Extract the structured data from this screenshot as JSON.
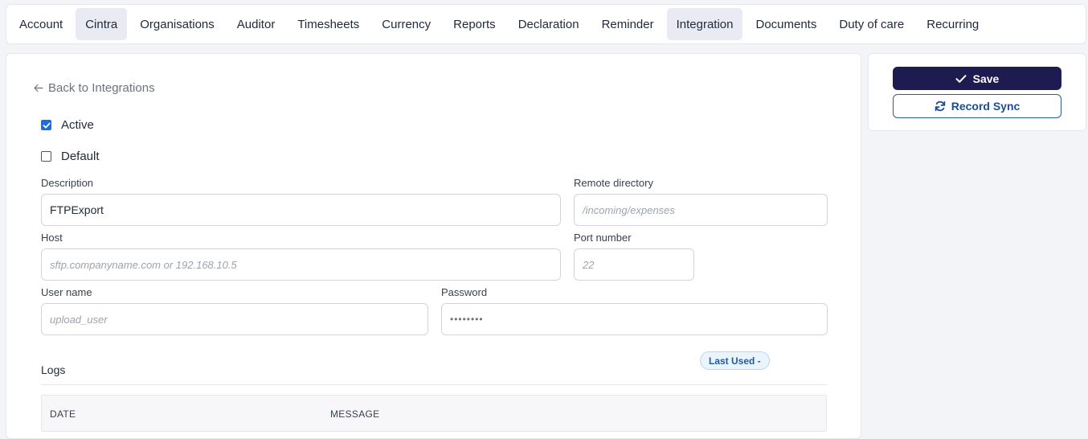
{
  "tabs": [
    {
      "label": "Account",
      "active": false
    },
    {
      "label": "Cintra",
      "active": true
    },
    {
      "label": "Organisations",
      "active": false
    },
    {
      "label": "Auditor",
      "active": false
    },
    {
      "label": "Timesheets",
      "active": false
    },
    {
      "label": "Currency",
      "active": false
    },
    {
      "label": "Reports",
      "active": false
    },
    {
      "label": "Declaration",
      "active": false
    },
    {
      "label": "Reminder",
      "active": false
    },
    {
      "label": "Integration",
      "active": true
    },
    {
      "label": "Documents",
      "active": false
    },
    {
      "label": "Duty of care",
      "active": false
    },
    {
      "label": "Recurring",
      "active": false
    }
  ],
  "actions": {
    "save_label": "Save",
    "save_icon": "check-icon",
    "sync_label": "Record Sync",
    "sync_icon": "refresh-icon"
  },
  "form": {
    "back_label": "Back to Integrations",
    "active_label": "Active",
    "active_checked": true,
    "default_label": "Default",
    "default_checked": false,
    "description_label": "Description",
    "description_value": "FTPExport",
    "remote_dir_label": "Remote directory",
    "remote_dir_placeholder": "/incoming/expenses",
    "host_label": "Host",
    "host_placeholder": "sftp.companyname.com or 192.168.10.5",
    "port_label": "Port number",
    "port_placeholder": "22",
    "username_label": "User name",
    "username_placeholder": "upload_user",
    "password_label": "Password",
    "password_value": "••••••••"
  },
  "logs": {
    "title": "Logs",
    "last_used_badge": "Last Used -",
    "columns": [
      "DATE",
      "MESSAGE"
    ]
  },
  "colors": {
    "primary": "#1d1b4f",
    "accent_blue": "#1e4e94",
    "checkbox_blue": "#1a6fe0",
    "active_tab_bg": "#e9eaf4"
  }
}
